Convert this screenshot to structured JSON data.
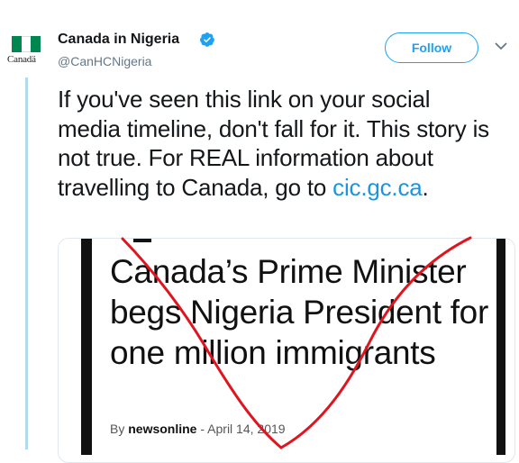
{
  "account": {
    "display_name": "Canada in Nigeria",
    "handle": "@CanHCNigeria",
    "avatar_wordmark": "Canadä",
    "verified_icon": "verified-badge-icon"
  },
  "actions": {
    "follow_label": "Follow",
    "more_icon": "chevron-down-icon"
  },
  "tweet": {
    "text": "If you've seen this link on your social media timeline, don't fall for it.  This story is not true.  For REAL information about travelling to Canada, go to ",
    "link_text": "cic.gc.ca",
    "after_link": "."
  },
  "card": {
    "headline": "Canada’s Prime Minister begs Nigeria President for one million immigrants",
    "by_prefix": "By",
    "author": "newsonline",
    "separator": "-",
    "date": "April 14, 2019"
  },
  "colors": {
    "accent": "#1da1f2",
    "link": "#1b95e0",
    "thread_line": "#b3d9ec",
    "annotation_red": "#e0141e"
  }
}
